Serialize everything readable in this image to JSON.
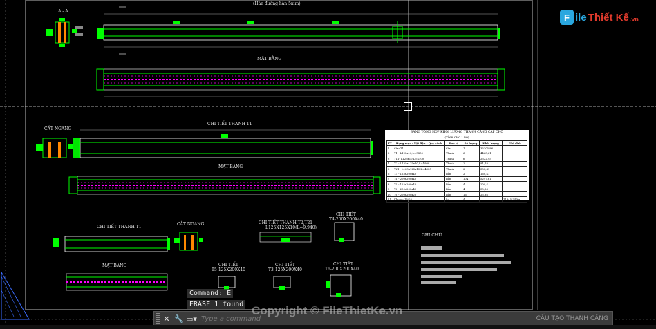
{
  "drawing": {
    "labels": {
      "section_aa": "A - A",
      "top_note": "(Hàn đường hàn 5mm)",
      "mat_bang_1": "MẶT BẰNG",
      "mat_bang_2": "MẶT BẰNG",
      "mat_bang_3": "MẶT BẰNG",
      "cat_ngang_1": "CẮT NGANG",
      "cat_ngang_2": "CẮT NGANG",
      "chi_tiet_t1_a": "CHI TIẾT THANH T1",
      "chi_tiet_t1_b": "CHI TIẾT THANH T1",
      "chi_tiet_t2": "CHI TIẾT THANH T2,T21-",
      "chi_tiet_t2_sub": "L125X125X10(L=9.940)",
      "chi_tiet_t4": "CHI TIẾT",
      "chi_tiet_t4_sub": "T4-200X200X40",
      "chi_tiet_t5": "CHI TIẾT",
      "chi_tiet_t5_sub": "T5-125X200X40",
      "chi_tiet_t3": "CHI TIẾT",
      "chi_tiet_t3_sub": "T3-125X200X40",
      "chi_tiet_t6": "CHI TIẾT",
      "chi_tiet_t6_sub": "T6-200X200X40",
      "ghi_chu": "GHI CHÚ"
    },
    "table": {
      "title": "BẢNG TỔNG HỢP KHỐI LƯỢNG THANH CĂNG CAP CHỐ",
      "subtitle": "(TÍNH CHO 1 BỘ)",
      "headers": [
        "TT",
        "Hạng mục - Vật liệu - Quy cách",
        "Đơn vị",
        "Số lượng",
        "Khối lượng",
        "Ghi chú"
      ],
      "rows": [
        [
          "1",
          "Cừu T1",
          "Cừu",
          "1",
          "35305,86",
          ""
        ],
        [
          "2",
          "T1 - L125x10,L=9800",
          "Thanh",
          "6",
          "4463,61",
          ""
        ],
        [
          "3",
          "T11- L125x10,L=4100",
          "Thanh",
          "6",
          "2322,95",
          ""
        ],
        [
          "4",
          "T2 - L125x125x10,L=1980",
          "Thanh",
          "2",
          "91,18",
          ""
        ],
        [
          "5",
          "T21 - L125x125x10,L=4300",
          "Thanh",
          "2",
          "353,49",
          ""
        ],
        [
          "6",
          "T3 - 125x200x40",
          "Bản",
          "2",
          "160,47",
          ""
        ],
        [
          "7",
          "T4 - 200x200x40",
          "Bản",
          "104",
          "5297,61",
          ""
        ],
        [
          "8",
          "T5 - 125x200x40",
          "Bản",
          "4",
          "209,4",
          ""
        ],
        [
          "9",
          "T6 - 200x200x40",
          "Bản",
          "4",
          "35,86",
          ""
        ],
        [
          "10",
          "T6 - 200x200x20",
          "Bản",
          "16",
          "25,86",
          ""
        ],
        [
          "11",
          "Khung: 15/25",
          "Lo",
          "4",
          "",
          "11345,24 kg"
        ]
      ]
    }
  },
  "logo": {
    "badge": "F",
    "word1": "ile",
    "word2": "Thiết Kế",
    "word3": ".vn"
  },
  "command": {
    "history_1": "Command: E",
    "history_2": "ERASE 1 found",
    "placeholder": "Type a command",
    "close_icon": "✕",
    "settings_icon": "🔧",
    "right_label": "CẤU TẠO THANH CĂNG"
  },
  "watermark": "Copyright © FileThietKe.vn",
  "colors": {
    "background": "#000000",
    "geometry": "#00ff00",
    "outline": "#ffffff",
    "rebar": "#ff00ff",
    "section": "#ff8800"
  }
}
